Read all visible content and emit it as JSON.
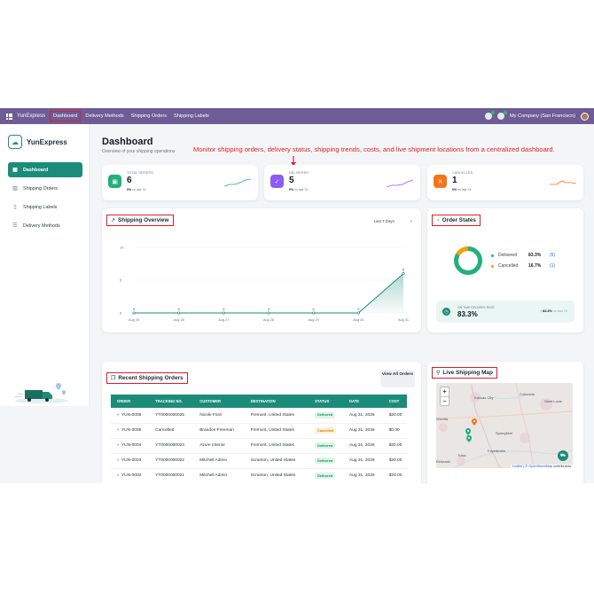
{
  "topbar": {
    "brand": "YunExpress",
    "nav": [
      "Dashboard",
      "Delivery Methods",
      "Shipping Orders",
      "Shipping Labels"
    ],
    "company": "My Company (San Francisco)",
    "icons": [
      "apps-grid-icon",
      "chat-icon",
      "activity-icon",
      "avatar"
    ]
  },
  "sidebar": {
    "logo_text": "YunExpress",
    "items": [
      {
        "label": "Dashboard",
        "icon": "grid-icon",
        "active": true
      },
      {
        "label": "Shipping Orders",
        "icon": "bar-chart-icon",
        "active": false
      },
      {
        "label": "Shipping Labels",
        "icon": "document-icon",
        "active": false
      },
      {
        "label": "Delivery Methods",
        "icon": "list-icon",
        "active": false
      }
    ]
  },
  "header": {
    "title": "Dashboard",
    "subtitle": "Overview of your shipping operations",
    "annotation": "Monitor shipping orders, delivery status, shipping trends, costs, and live shipment locations from a centralized dashboard."
  },
  "stats": [
    {
      "label": "TOTAL ORDERS",
      "value": "6",
      "trend_pct": "0%",
      "trend_text": "vs last 7d",
      "color": "#22b07d",
      "icon": "box-icon"
    },
    {
      "label": "DELIVERED",
      "value": "5",
      "trend_pct": "0%",
      "trend_text": "vs last 7d",
      "color": "#8b5cf6",
      "icon": "check-icon"
    },
    {
      "label": "CANCELLED",
      "value": "1",
      "trend_pct": "0%",
      "trend_text": "vs last 7d",
      "color": "#f97316",
      "icon": "close-icon"
    }
  ],
  "overview": {
    "title": "Shipping Overview",
    "range": "Last 7 Days"
  },
  "chart_data": {
    "type": "area",
    "title": "Shipping Overview",
    "categories": [
      "Aug 25",
      "Aug 26",
      "Aug 27",
      "Aug 28",
      "Aug 29",
      "Aug 30",
      "Aug 31"
    ],
    "values": [
      0,
      0,
      0,
      0,
      0,
      0,
      6
    ],
    "y_ticks": [
      "0",
      "5",
      "10"
    ],
    "ylim": [
      0,
      10
    ],
    "color": "#1c8c7a"
  },
  "order_states": {
    "title": "Order States",
    "items": [
      {
        "label": "Delivered",
        "pct": "83.3%",
        "count": "(5)",
        "color": "#22b07d"
      },
      {
        "label": "Cancelled",
        "pct": "16.7%",
        "count": "(1)",
        "color": "#f59e0b"
      }
    ],
    "donut": [
      83.3,
      16.7
    ],
    "ontime_label": "ON-TIME DELIVERY RATE",
    "ontime_value": "83.3%",
    "ontime_trend": "83.3%",
    "ontime_trend_text": "vs last 7d"
  },
  "recent": {
    "title": "Recent Shipping Orders",
    "view_all": "View All Orders",
    "columns": [
      "ORDER",
      "TRACKING NO.",
      "CUSTOMER",
      "DESTINATION",
      "STATUS",
      "DATE",
      "COST"
    ],
    "rows": [
      [
        "YUN-0006",
        "YT0000000025",
        "Nicole Ford",
        "Fremont, United States",
        "Delivered",
        "Aug 31, 2026",
        "$20.00"
      ],
      [
        "YUN-0005",
        "Cancelled",
        "Brandon Freeman",
        "Fremont, United States",
        "Cancelled",
        "Aug 31, 2026",
        "$0.00"
      ],
      [
        "YUN-0004",
        "YT0000000023",
        "Azure Interior",
        "Fremont, United States",
        "Delivered",
        "Aug 31, 2026",
        "$20.00"
      ],
      [
        "YUN-0003",
        "YT0000000022",
        "Mitchell Admin",
        "Scranton, United States",
        "Delivered",
        "Aug 31, 2026",
        "$20.00"
      ],
      [
        "YUN-0002",
        "YT0000000021",
        "Mitchell Admin",
        "Scranton, United States",
        "Delivered",
        "Aug 31, 2026",
        "$20.00"
      ]
    ]
  },
  "map": {
    "title": "Live Shipping Map",
    "zoom_in": "+",
    "zoom_out": "−",
    "labels": [
      "Kansas City",
      "Columbia",
      "Saint Louis",
      "Wichita",
      "Springfield",
      "Tulsa",
      "Fayetteville",
      "Eldorado"
    ],
    "attribution_leaflet": "Leaflet",
    "attribution_sep": " | © ",
    "attribution_osm": "OpenStreetMap",
    "attribution_tail": " contributors"
  }
}
